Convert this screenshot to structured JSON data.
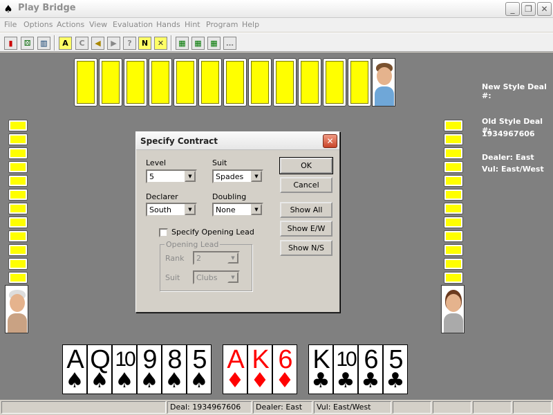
{
  "window": {
    "title": "Play Bridge"
  },
  "menu": [
    "File",
    "Options",
    "Actions",
    "View",
    "Evaluation",
    "Hands",
    "Hint",
    "Program",
    "Help"
  ],
  "toolbar": {
    "buttons": [
      "A",
      "C",
      "?",
      "N"
    ]
  },
  "info": {
    "new_style_label": "New Style Deal #:",
    "old_style_label": "Old Style Deal #:",
    "old_style_value": "1934967606",
    "dealer": "Dealer: East",
    "vul": "Vul: East/West"
  },
  "dialog": {
    "title": "Specify Contract",
    "level_label": "Level",
    "level_value": "5",
    "suit_label": "Suit",
    "suit_value": "Spades",
    "declarer_label": "Declarer",
    "declarer_value": "South",
    "doubling_label": "Doubling",
    "doubling_value": "None",
    "checkbox_label": "Specify Opening Lead",
    "group_title": "Opening Lead",
    "rank_label": "Rank",
    "rank_value": "2",
    "lead_suit_label": "Suit",
    "lead_suit_value": "Clubs",
    "buttons": {
      "ok": "OK",
      "cancel": "Cancel",
      "show_all": "Show All",
      "show_ew": "Show E/W",
      "show_ns": "Show N/S"
    }
  },
  "south_hand": [
    {
      "rank": "A",
      "suit": "♠"
    },
    {
      "rank": "Q",
      "suit": "♠"
    },
    {
      "rank": "10",
      "suit": "♠"
    },
    {
      "rank": "9",
      "suit": "♠"
    },
    {
      "rank": "8",
      "suit": "♠"
    },
    {
      "rank": "5",
      "suit": "♠"
    },
    {
      "rank": "A",
      "suit": "♦"
    },
    {
      "rank": "K",
      "suit": "♦"
    },
    {
      "rank": "6",
      "suit": "♦"
    },
    {
      "rank": "K",
      "suit": "♣"
    },
    {
      "rank": "10",
      "suit": "♣"
    },
    {
      "rank": "6",
      "suit": "♣"
    },
    {
      "rank": "5",
      "suit": "♣"
    }
  ],
  "status": {
    "deal": "Deal: 1934967606",
    "dealer": "Dealer: East",
    "vul": "Vul: East/West"
  }
}
